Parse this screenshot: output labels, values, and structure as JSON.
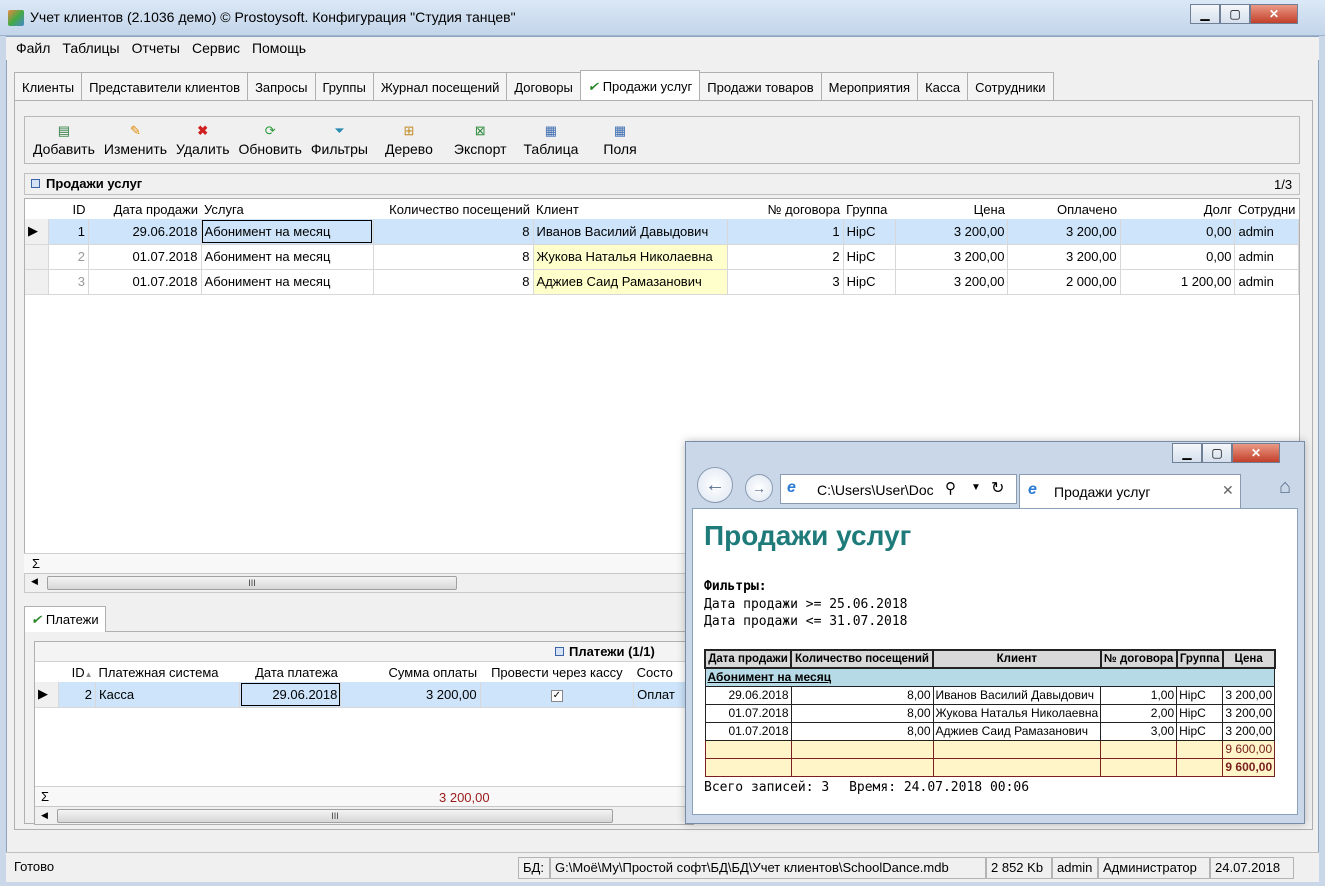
{
  "window": {
    "title": "Учет клиентов (2.1036 демо) © Prostoysoft. Конфигурация \"Студия танцев\""
  },
  "menu": [
    "Файл",
    "Таблицы",
    "Отчеты",
    "Сервис",
    "Помощь"
  ],
  "tabs": [
    "Клиенты",
    "Представители клиентов",
    "Запросы",
    "Группы",
    "Журнал посещений",
    "Договоры",
    "Продажи услуг",
    "Продажи товаров",
    "Мероприятия",
    "Касса",
    "Сотрудники"
  ],
  "active_tab": "Продажи услуг",
  "toolbar": {
    "add": "Добавить",
    "edit": "Изменить",
    "delete": "Удалить",
    "refresh": "Обновить",
    "filters": "Фильтры",
    "tree": "Дерево",
    "export": "Экспорт",
    "table": "Таблица",
    "fields": "Поля"
  },
  "sales": {
    "title": "Продажи услуг",
    "pages": "1/3",
    "columns": [
      "ID",
      "Дата продажи",
      "Услуга",
      "Количество посещений",
      "Клиент",
      "№ договора",
      "Группа",
      "Цена",
      "Оплачено",
      "Долг",
      "Сотрудни"
    ],
    "rows": [
      {
        "id": "1",
        "date": "29.06.2018",
        "service": "Абонимент на месяц",
        "visits": "8",
        "client": "Иванов Василий Давыдович",
        "contract": "1",
        "group": "HipC",
        "price": "3 200,00",
        "paid": "3 200,00",
        "debt": "0,00",
        "employee": "admin"
      },
      {
        "id": "2",
        "date": "01.07.2018",
        "service": "Абонимент на месяц",
        "visits": "8",
        "client": "Жукова Наталья Николаевна",
        "contract": "2",
        "group": "HipC",
        "price": "3 200,00",
        "paid": "3 200,00",
        "debt": "0,00",
        "employee": "admin"
      },
      {
        "id": "3",
        "date": "01.07.2018",
        "service": "Абонимент на месяц",
        "visits": "8",
        "client": "Аджиев Саид Рамазанович",
        "contract": "3",
        "group": "HipC",
        "price": "3 200,00",
        "paid": "2 000,00",
        "debt": "1 200,00",
        "employee": "admin"
      }
    ],
    "sigma": "Σ"
  },
  "payments": {
    "tab": "Платежи",
    "title": "Платежи (1/1)",
    "columns": [
      "ID",
      "Платежная система",
      "Дата платежа",
      "Сумма оплаты",
      "Провести через кассу",
      "Состо"
    ],
    "rows": [
      {
        "id": "2",
        "system": "Касса",
        "date": "29.06.2018",
        "amount": "3 200,00",
        "via_cash": true,
        "state": "Оплат"
      }
    ],
    "total": "3 200,00",
    "sigma": "Σ"
  },
  "status": {
    "ready": "Готово",
    "db_label": "БД:",
    "db_path": "G:\\Моё\\Му\\Простой софт\\БД\\БД\\Учет клиентов\\SchoolDance.mdb",
    "size": "2 852 Kb",
    "user": "admin",
    "role": "Администратор",
    "date": "24.07.2018"
  },
  "browser": {
    "address": "C:\\Users\\User\\Doc",
    "tab_title": "Продажи услуг",
    "report": {
      "title": "Продажи услуг",
      "filters_label": "Фильтры:",
      "filter_1": "Дата продажи >= 25.06.2018",
      "filter_2": "Дата продажи <= 31.07.2018",
      "columns": [
        "Дата продажи",
        "Количество посещений",
        "Клиент",
        "№ договора",
        "Группа",
        "Цена"
      ],
      "group": "Абонимент на месяц",
      "rows": [
        {
          "date": "29.06.2018",
          "visits": "8,00",
          "client": "Иванов Василий Давыдович",
          "contract": "1,00",
          "group": "HipC",
          "price": "3 200,00"
        },
        {
          "date": "01.07.2018",
          "visits": "8,00",
          "client": "Жукова Наталья Николаевна",
          "contract": "2,00",
          "group": "HipC",
          "price": "3 200,00"
        },
        {
          "date": "01.07.2018",
          "visits": "8,00",
          "client": "Аджиев Саид Рамазанович",
          "contract": "3,00",
          "group": "HipC",
          "price": "3 200,00"
        }
      ],
      "subtotal": "9 600,00",
      "total": "9 600,00",
      "footer_records": "Всего записей: 3",
      "footer_time": "Время: 24.07.2018 00:06"
    }
  }
}
